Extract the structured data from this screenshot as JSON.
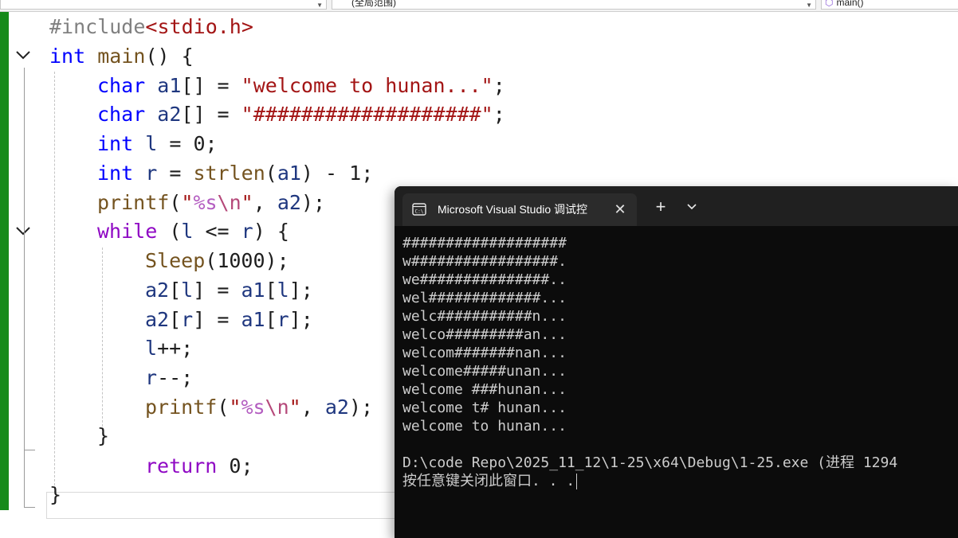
{
  "navbar": {
    "scope_label": "(全局范围)",
    "member_label": "main()"
  },
  "editor": {
    "lines": {
      "l1": {
        "hash_include": "#include",
        "lt": "<",
        "header": "stdio.h",
        "gt": ">"
      },
      "l2": {
        "kw": "int",
        "name": "main",
        "rest": "() {"
      },
      "l3": {
        "kw": "char",
        "var": "a1",
        "mid": "[] = ",
        "str": "\"welcome to hunan...\"",
        "end": ";"
      },
      "l4": {
        "kw": "char",
        "var": "a2",
        "mid": "[] = ",
        "str": "\"###################\"",
        "end": ";"
      },
      "l5": {
        "kw": "int",
        "var": "l",
        "mid": " = ",
        "num": "0",
        "end": ";"
      },
      "l6": {
        "kw": "int",
        "var": "r",
        "mid": " = ",
        "fn": "strlen",
        "p1": "(",
        "var2": "a1",
        "p2": ") - ",
        "num": "1",
        "end": ";"
      },
      "l7": {
        "fn": "printf",
        "p1": "(",
        "q1": "\"",
        "fmt": "%s",
        "esc": "\\n",
        "q2": "\"",
        "p2": ", ",
        "var": "a2",
        "end": ");"
      },
      "l8": {
        "kw": "while",
        "p1": " (",
        "var": "l",
        "op": " <= ",
        "var2": "r",
        "end": ") {"
      },
      "l9": {
        "fn": "Sleep",
        "p1": "(",
        "num": "1000",
        "end": ");"
      },
      "l10": {
        "var": "a2",
        "b1": "[",
        "idx": "l",
        "b2": "] = ",
        "var2": "a1",
        "b3": "[",
        "idx2": "l",
        "end": "];"
      },
      "l11": {
        "var": "a2",
        "b1": "[",
        "idx": "r",
        "b2": "] = ",
        "var2": "a1",
        "b3": "[",
        "idx2": "r",
        "end": "];"
      },
      "l12": {
        "var": "l",
        "end": "++;"
      },
      "l13": {
        "var": "r",
        "end": "--;"
      },
      "l14": {
        "fn": "printf",
        "p1": "(",
        "q1": "\"",
        "fmt": "%s",
        "esc": "\\n",
        "q2": "\"",
        "p2": ", ",
        "var": "a2",
        "end": ");"
      },
      "l15": {
        "brace": "}"
      },
      "l16": {
        "kw": "return",
        "sp": " ",
        "num": "0",
        "end": ";"
      },
      "l17": {
        "brace": "}"
      }
    }
  },
  "console": {
    "tab_title": "Microsoft Visual Studio 调试控",
    "close_glyph": "✕",
    "new_tab_glyph": "+",
    "dropdown_glyph": "⌄",
    "output": [
      "###################",
      "w#################.",
      "we###############..",
      "wel#############...",
      "welc###########n...",
      "welco#########an...",
      "welcom#######nan...",
      "welcome#####unan...",
      "welcome ###hunan...",
      "welcome t# hunan...",
      "welcome to hunan...",
      "",
      "D:\\code Repo\\2025_11_12\\1-25\\x64\\Debug\\1-25.exe (进程 1294",
      "按任意键关闭此窗口. . ."
    ]
  },
  "colors": {
    "keyword": "#0000ff",
    "string": "#a31515",
    "function": "#74531f",
    "variable": "#1f377f",
    "control_keyword": "#8f08c4",
    "gutter_changed": "#168a1a",
    "console_bg": "#0c0c0c"
  }
}
